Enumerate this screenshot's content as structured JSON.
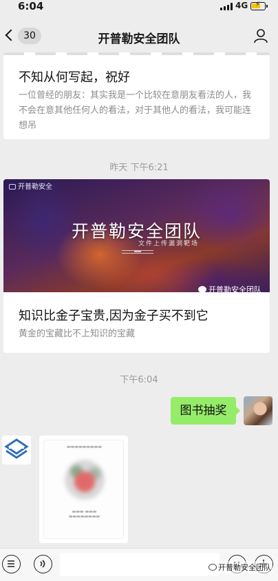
{
  "status_bar": {
    "time": "6:04",
    "network": "4G"
  },
  "header": {
    "unread_count": "30",
    "title": "开普勒安全团队"
  },
  "messages": {
    "card1": {
      "title": "不知从何写起，祝好",
      "desc": "一位曾经的朋友：其实我是一个比较在意朋友看法的人，我不会在意其他任何人的看法，对于其他人的看法，我可能连想吊"
    },
    "time1": "昨天 下午6:21",
    "card2": {
      "cover_logo": "开普勒安全",
      "cover_title": "开普勒安全团队",
      "cover_subtitle": "文件上传漏洞靶场",
      "cover_watermark": "开普勒安全团队",
      "title": "知识比金子宝贵,因为金子买不到它",
      "desc": "黄金的宝藏比不上知识的宝藏"
    },
    "time2": "下午6:04",
    "outgoing_text": "图书抽奖"
  },
  "input_bar": {
    "watermark": "开普勒安全团队"
  },
  "colors": {
    "bubble_green": "#95ec69",
    "background": "#ededed",
    "card_white": "#ffffff"
  },
  "icons": [
    "back-chevron-icon",
    "profile-icon",
    "menu-icon",
    "voice-icon",
    "emoji-icon",
    "plus-icon"
  ]
}
